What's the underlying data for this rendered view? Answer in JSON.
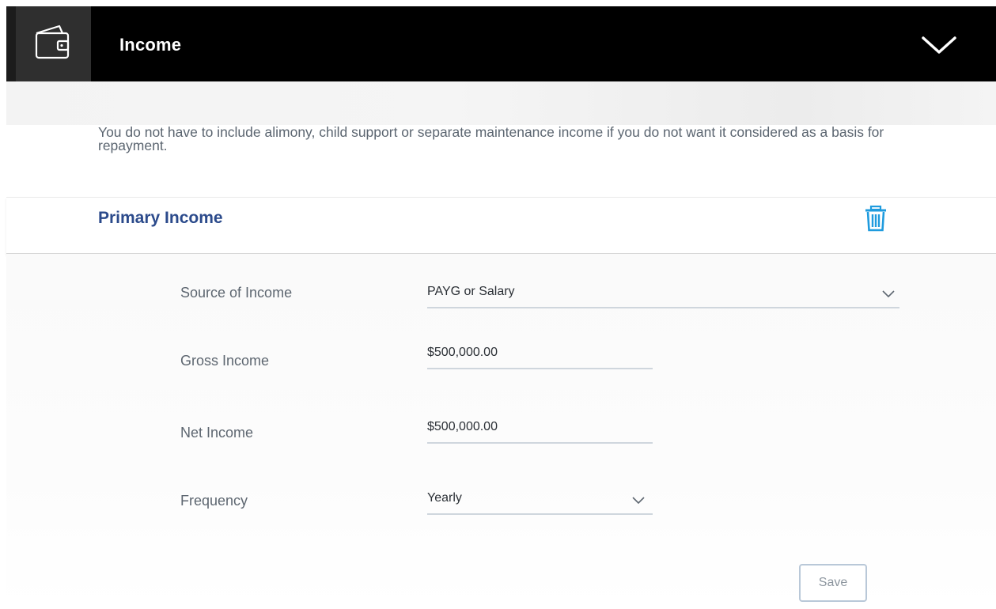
{
  "header": {
    "title": "Income",
    "icon": "wallet-icon",
    "toggle_icon": "chevron-down-icon",
    "background": "#000000"
  },
  "notice": {
    "text": "You do not have to include alimony, child support or separate maintenance income if you do not want it considered as a basis for repayment."
  },
  "section": {
    "title": "Primary Income",
    "delete_icon": "trash-icon",
    "title_color": "#2b4a8b",
    "icon_color": "#1f9bde"
  },
  "form": {
    "source": {
      "label": "Source of Income",
      "value": "PAYG or Salary"
    },
    "gross": {
      "label": "Gross Income",
      "value": "$500,000.00"
    },
    "net": {
      "label": "Net Income",
      "value": "$500,000.00"
    },
    "frequency": {
      "label": "Frequency",
      "value": "Yearly"
    }
  },
  "actions": {
    "save_label": "Save"
  }
}
